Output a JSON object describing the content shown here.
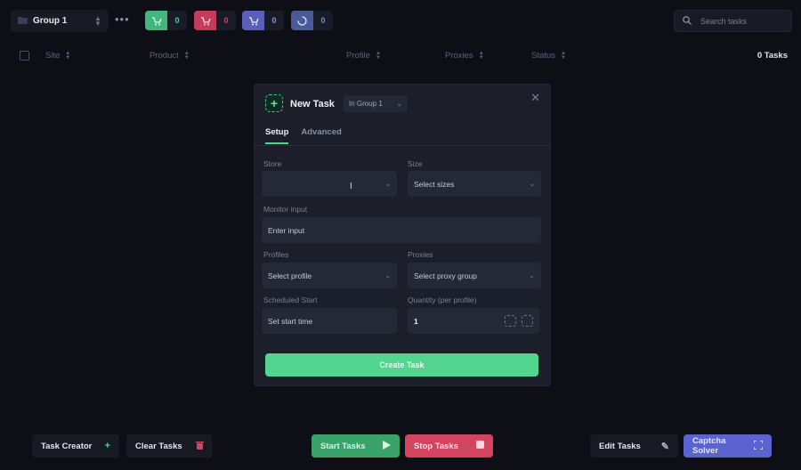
{
  "topbar": {
    "group_label": "Group 1",
    "more_glyph": "•••",
    "stats": [
      {
        "name": "success",
        "value": "0",
        "color": "#41b77b",
        "icon": "cart-check-icon"
      },
      {
        "name": "failed",
        "value": "0",
        "color": "#c53b5a",
        "icon": "cart-x-icon"
      },
      {
        "name": "queue",
        "value": "0",
        "color": "#5a5fb7",
        "icon": "cart-clock-icon"
      },
      {
        "name": "running",
        "value": "0",
        "color": "#4a5a98",
        "icon": "loading-icon"
      }
    ],
    "search_placeholder": "Search tasks"
  },
  "table": {
    "columns": [
      "Site",
      "Product",
      "Profile",
      "Proxies",
      "Status"
    ],
    "task_count": "0 Tasks"
  },
  "modal": {
    "title": "New Task",
    "group_chip": "In Group 1",
    "tabs": [
      "Setup",
      "Advanced"
    ],
    "active_tab": "Setup",
    "fields": {
      "store": {
        "label": "Store",
        "value": ""
      },
      "size": {
        "label": "Size",
        "value": "Select sizes"
      },
      "monitor": {
        "label": "Monitor input",
        "value": "Enter input"
      },
      "profiles": {
        "label": "Profiles",
        "value": "Select profile"
      },
      "proxies": {
        "label": "Proxies",
        "value": "Select proxy group"
      },
      "schedule": {
        "label": "Scheduled Start",
        "value": "Set start time"
      },
      "quantity": {
        "label": "Quantity (per profile)",
        "value": "1"
      }
    },
    "create_label": "Create Task"
  },
  "bottombar": {
    "task_creator": "Task Creator",
    "clear_tasks": "Clear Tasks",
    "start_tasks": "Start Tasks",
    "stop_tasks": "Stop Tasks",
    "edit_tasks": "Edit Tasks",
    "captcha_solver": "Captcha Solver"
  },
  "colors": {
    "accent_green": "#52d58f",
    "start_green": "#3aa36a",
    "stop_red": "#d2445f",
    "captcha_blue": "#5b63d0"
  }
}
